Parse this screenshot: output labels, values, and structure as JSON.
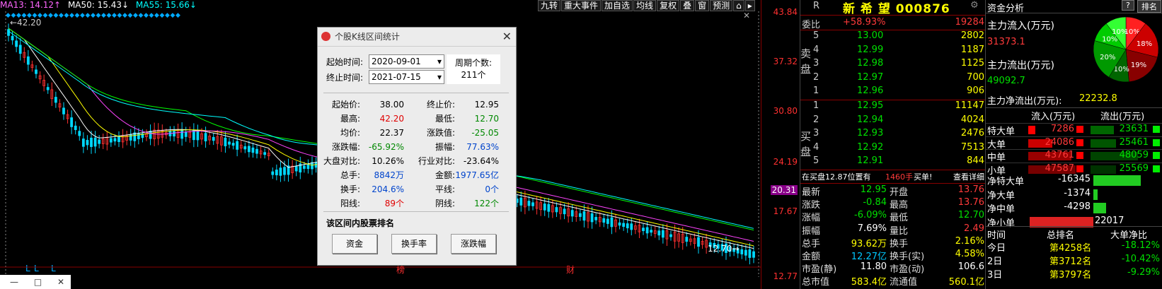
{
  "indicator_bar": {
    "ma13": "MA13: 14.12↑",
    "ma50": "MA50: 15.43↓",
    "ma55": "MA55: 15.66↓"
  },
  "toolbar": [
    "九转",
    "重大事件",
    "加自选",
    "均线",
    "复权",
    "叠",
    "窗",
    "预测"
  ],
  "chart": {
    "high_label": "42.20",
    "low_label": "12.70",
    "bottom_markers": [
      "L",
      "L",
      "L"
    ],
    "event_labels": [
      "榜",
      "财"
    ]
  },
  "price_axis": [
    "43.84",
    "37.32",
    "30.80",
    "24.19",
    "20.31",
    "17.67",
    "12.77"
  ],
  "dialog": {
    "title": "个股K线区间统计",
    "start_label": "起始时间:",
    "start_value": "2020-09-01",
    "end_label": "终止时间:",
    "end_value": "2021-07-15",
    "period_label": "周期个数:",
    "period_value": "211个",
    "stats": [
      {
        "l1": "起始价:",
        "v1": "38.00",
        "c1": "black",
        "l2": "终止价:",
        "v2": "12.95",
        "c2": "black"
      },
      {
        "l1": "最高:",
        "v1": "42.20",
        "c1": "red",
        "l2": "最低:",
        "v2": "12.70",
        "c2": "green"
      },
      {
        "l1": "均价:",
        "v1": "22.37",
        "c1": "black",
        "l2": "涨跌值:",
        "v2": "-25.05",
        "c2": "green"
      },
      {
        "l1": "涨跌幅:",
        "v1": "-65.92%",
        "c1": "green",
        "l2": "振幅:",
        "v2": "77.63%",
        "c2": "blue"
      },
      {
        "l1": "大盘对比:",
        "v1": "10.26%",
        "c1": "black",
        "l2": "行业对比:",
        "v2": "-23.64%",
        "c2": "black"
      },
      {
        "l1": "总手:",
        "v1": "8842万",
        "c1": "blue",
        "l2": "金额:",
        "v2": "1977.65亿",
        "c2": "blue"
      },
      {
        "l1": "换手:",
        "v1": "204.6%",
        "c1": "blue",
        "l2": "平线:",
        "v2": "0个",
        "c2": "blue"
      },
      {
        "l1": "阳线:",
        "v1": "89个",
        "c1": "red",
        "l2": "阴线:",
        "v2": "122个",
        "c2": "green"
      }
    ],
    "ranking_title": "该区间内股票排名",
    "buttons": [
      "资金",
      "换手率",
      "涨跌幅"
    ]
  },
  "quote": {
    "badge": "R",
    "title": "新 希 望 000876",
    "wei_label": "委比",
    "wei_pct": "+58.93%",
    "wei_val": "19284",
    "sell_label": [
      "卖",
      "盘"
    ],
    "buy_label": [
      "买",
      "盘"
    ],
    "sell": [
      {
        "n": "5",
        "p": "13.00",
        "v": "2802"
      },
      {
        "n": "4",
        "p": "12.99",
        "v": "1187"
      },
      {
        "n": "3",
        "p": "12.98",
        "v": "1125"
      },
      {
        "n": "2",
        "p": "12.97",
        "v": "700"
      },
      {
        "n": "1",
        "p": "12.96",
        "v": "906"
      }
    ],
    "buy": [
      {
        "n": "1",
        "p": "12.95",
        "v": "11147"
      },
      {
        "n": "2",
        "p": "12.94",
        "v": "4024"
      },
      {
        "n": "3",
        "p": "12.93",
        "v": "2476"
      },
      {
        "n": "4",
        "p": "12.92",
        "v": "7513"
      },
      {
        "n": "5",
        "p": "12.91",
        "v": "844"
      }
    ],
    "notice": "在买盘12.87位置有",
    "notice_qty": "1460手",
    "notice_action": "买单!",
    "detail": "查看详细",
    "fields": [
      {
        "l": "最新",
        "v": "12.95",
        "c": "green",
        "l2": "开盘",
        "v2": "13.76",
        "c2": "red"
      },
      {
        "l": "涨跌",
        "v": "-0.84",
        "c": "green",
        "l2": "最高",
        "v2": "13.76",
        "c2": "red"
      },
      {
        "l": "涨幅",
        "v": "-6.09%",
        "c": "green",
        "l2": "最低",
        "v2": "12.70",
        "c2": "green"
      },
      {
        "l": "振幅",
        "v": "7.69%",
        "c": "white",
        "l2": "量比",
        "v2": "2.49",
        "c2": "red"
      },
      {
        "l": "总手",
        "v": "93.62万",
        "c": "yellow",
        "l2": "换手",
        "v2": "2.16%",
        "c2": "yellow"
      },
      {
        "l": "金额",
        "v": "12.27亿",
        "c": "cyan",
        "l2": "换手(实)",
        "v2": "4.58%",
        "c2": "yellow"
      },
      {
        "l": "市盈(静)",
        "v": "11.80",
        "c": "white",
        "l2": "市盈(动)",
        "v2": "106.6",
        "c2": "white"
      },
      {
        "l": "总市值",
        "v": "583.4亿",
        "c": "yellow",
        "l2": "流通值",
        "v2": "560.1亿",
        "c2": "yellow"
      }
    ]
  },
  "flow": {
    "title": "资金分析",
    "help": "?",
    "more": "排名",
    "inflow_label": "主力流入(万元)",
    "inflow_val": "31373.1",
    "outflow_label": "主力流出(万元)",
    "outflow_val": "49092.7",
    "net_label": "主力净流出(万元):",
    "net_val": "22232.8",
    "pie": [
      {
        "label": "10%",
        "value": 10,
        "color": "#ff2020"
      },
      {
        "label": "18%",
        "value": 18,
        "color": "#cc0000"
      },
      {
        "label": "19%",
        "value": 19,
        "color": "#880000"
      },
      {
        "label": "10%",
        "value": 10,
        "color": "#006600"
      },
      {
        "label": "20%",
        "value": 20,
        "color": "#009900"
      },
      {
        "label": "10%",
        "value": 10,
        "color": "#00cc00"
      },
      {
        "label": "10%",
        "value": 10,
        "color": "#33ff33"
      }
    ],
    "col_in": "流入(万元)",
    "col_out": "流出(万元)",
    "table": [
      {
        "l": "特大单",
        "in": "7286",
        "out": "23631"
      },
      {
        "l": "大单",
        "in": "24086",
        "out": "25461"
      },
      {
        "l": "中单",
        "in": "43761",
        "out": "48059"
      },
      {
        "l": "小单",
        "in": "47587",
        "out": "25569"
      }
    ],
    "net": [
      {
        "l": "净特大单",
        "v": "-16345",
        "c": "green"
      },
      {
        "l": "净大单",
        "v": "-1374",
        "c": "green"
      },
      {
        "l": "净中单",
        "v": "-4298",
        "c": "green"
      },
      {
        "l": "净小单",
        "v": "22017",
        "c": "red"
      }
    ],
    "rank_cols": [
      "时间",
      "总排名",
      "大单净比"
    ],
    "rank": [
      {
        "t": "今日",
        "r": "第4258名",
        "p": "-18.12%"
      },
      {
        "t": "2日",
        "r": "第3712名",
        "p": "-10.42%"
      },
      {
        "t": "3日",
        "r": "第3797名",
        "p": "-9.29%"
      }
    ]
  }
}
